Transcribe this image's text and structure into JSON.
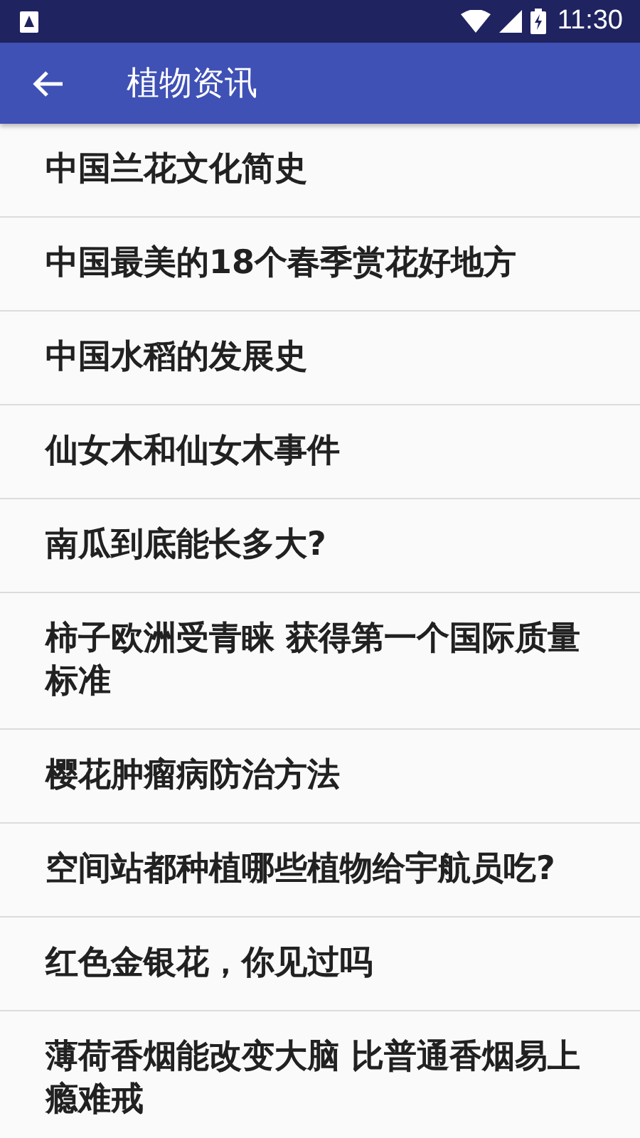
{
  "status_bar": {
    "time": "11:30"
  },
  "toolbar": {
    "title": "植物资讯"
  },
  "articles": [
    {
      "title": "中国兰花文化简史"
    },
    {
      "title": "中国最美的18个春季赏花好地方"
    },
    {
      "title": "中国水稻的发展史"
    },
    {
      "title": "仙女木和仙女木事件"
    },
    {
      "title": "南瓜到底能长多大?"
    },
    {
      "title": "柿子欧洲受青睐 获得第一个国际质量标准"
    },
    {
      "title": "樱花肿瘤病防治方法"
    },
    {
      "title": "空间站都种植哪些植物给宇航员吃?"
    },
    {
      "title": "红色金银花，你见过吗"
    },
    {
      "title": "薄荷香烟能改变大脑 比普通香烟易上瘾难戒"
    }
  ]
}
